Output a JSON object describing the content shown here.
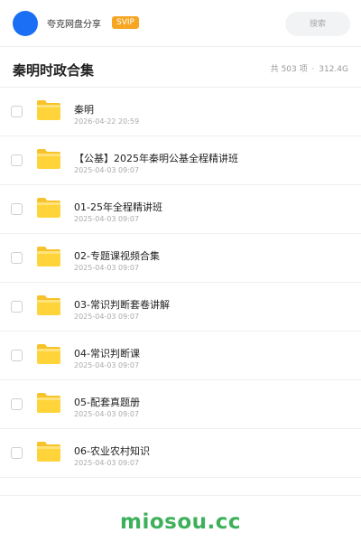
{
  "header": {
    "brand_name": "夸克网盘分享",
    "badge": "SVIP",
    "search_placeholder": "搜索",
    "avatar_color": "#1a6ff5",
    "badge_color": "#f6a623"
  },
  "share": {
    "title": "秦明时政合集",
    "count_text": "共 503 项",
    "separator": "·",
    "size_text": "312.4G"
  },
  "files": [
    {
      "name": "秦明",
      "date": "2026-04-22 20:59",
      "icon": "folder-icon"
    },
    {
      "name": "【公基】2025年秦明公基全程精讲班",
      "date": "2025-04-03 09:07",
      "icon": "folder-icon"
    },
    {
      "name": "01-25年全程精讲班",
      "date": "2025-04-03 09:07",
      "icon": "folder-icon"
    },
    {
      "name": "02-专题课视频合集",
      "date": "2025-04-03 09:07",
      "icon": "folder-icon"
    },
    {
      "name": "03-常识判断套卷讲解",
      "date": "2025-04-03 09:07",
      "icon": "folder-icon"
    },
    {
      "name": "04-常识判断课",
      "date": "2025-04-03 09:07",
      "icon": "folder-icon"
    },
    {
      "name": "05-配套真题册",
      "date": "2025-04-03 09:07",
      "icon": "folder-icon"
    },
    {
      "name": "06-农业农村知识",
      "date": "2025-04-03 09:07",
      "icon": "folder-icon"
    }
  ],
  "footer": {
    "watermark": "miosou.cc",
    "watermark_color": "#3db05a"
  }
}
